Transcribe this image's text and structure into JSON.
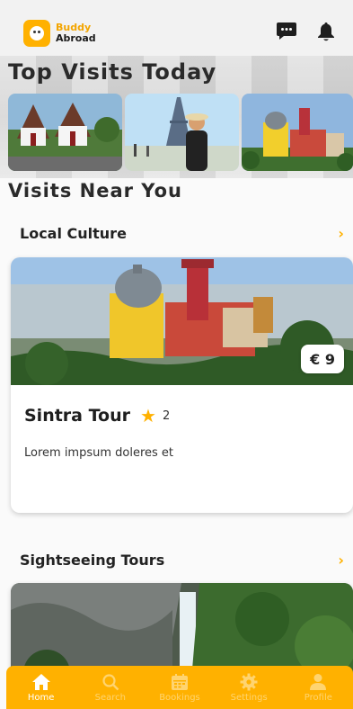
{
  "header": {
    "logo_line1": "Buddy",
    "logo_line2": "Abroad",
    "icons": [
      "chat-icon",
      "bell-icon"
    ]
  },
  "top_visits": {
    "title": "Top Visits Today"
  },
  "near_you": {
    "title": "Visits Near You",
    "categories": [
      {
        "label": "Local Culture",
        "chevron": "›",
        "card": {
          "title": "Sintra Tour",
          "rating": "2",
          "price": "€ 9",
          "description": "Lorem impsum doleres et"
        }
      },
      {
        "label": "Sightseeing Tours",
        "chevron": "›"
      }
    ]
  },
  "bottom_nav": {
    "items": [
      {
        "label": "Home",
        "icon": "home-icon",
        "active": true
      },
      {
        "label": "Search",
        "icon": "search-icon",
        "active": false
      },
      {
        "label": "Bookings",
        "icon": "calendar-icon",
        "active": false
      },
      {
        "label": "Settings",
        "icon": "gear-icon",
        "active": false
      },
      {
        "label": "Profile",
        "icon": "person-icon",
        "active": false
      }
    ]
  },
  "colors": {
    "accent": "#ffb100",
    "nav_inactive": "#ffd470",
    "nav_active": "#ffffff"
  }
}
